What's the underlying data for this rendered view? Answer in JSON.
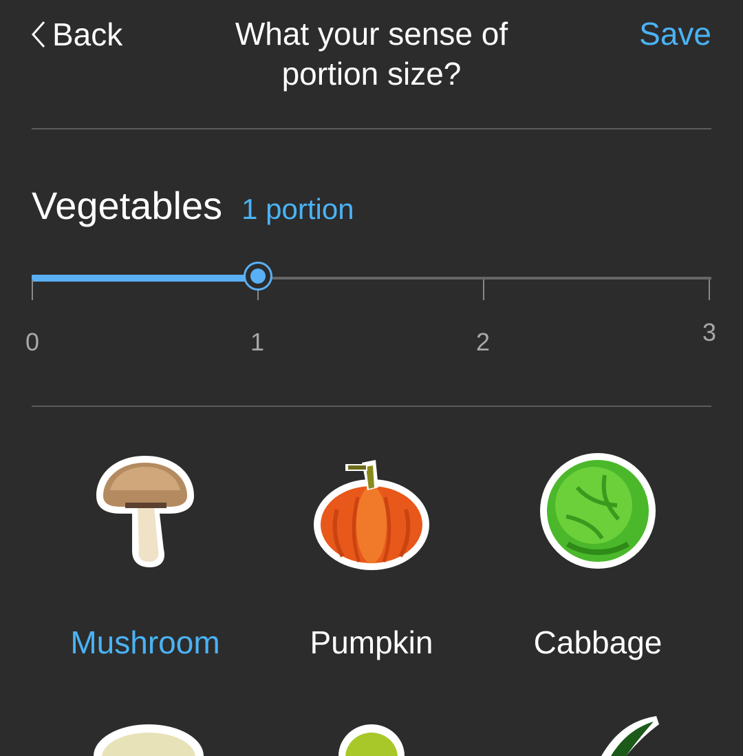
{
  "nav": {
    "back_label": "Back",
    "title_line1": "What your sense of",
    "title_line2": "portion size?",
    "save_label": "Save"
  },
  "category": {
    "title": "Vegetables",
    "value_text": "1 portion"
  },
  "slider": {
    "min": 0,
    "max": 3,
    "value": 1,
    "ticks": [
      "0",
      "1",
      "2",
      "3"
    ]
  },
  "items": [
    {
      "label": "Mushroom",
      "icon": "mushroom-icon",
      "selected": true
    },
    {
      "label": "Pumpkin",
      "icon": "pumpkin-icon",
      "selected": false
    },
    {
      "label": "Cabbage",
      "icon": "cabbage-icon",
      "selected": false
    }
  ],
  "colors": {
    "background": "#2c2c2c",
    "accent": "#4ab3f4",
    "divider": "#5c5c5c"
  }
}
